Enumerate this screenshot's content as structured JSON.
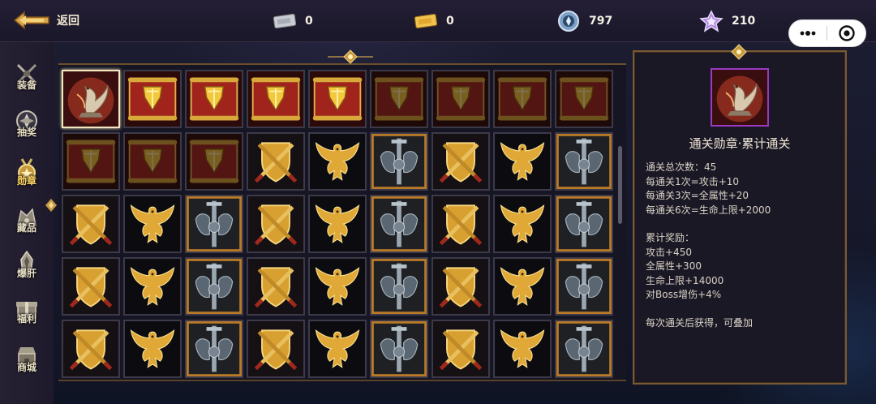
{
  "topbar": {
    "back_label": "返回",
    "currencies": [
      {
        "icon": "silver-ticket-icon",
        "value": "0"
      },
      {
        "icon": "gold-ticket-icon",
        "value": "0"
      },
      {
        "icon": "crystal-coin-icon",
        "value": "797"
      },
      {
        "icon": "purple-star-gem-icon",
        "value": "210"
      }
    ]
  },
  "sidenav": {
    "items": [
      {
        "label": "装备",
        "icon": "crossed-swords-icon"
      },
      {
        "label": "抽奖",
        "icon": "lottery-emblem-icon"
      },
      {
        "label": "勋章",
        "icon": "medal-icon",
        "active": true
      },
      {
        "label": "藏品",
        "icon": "collection-icon"
      },
      {
        "label": "爆肝",
        "icon": "grind-icon"
      },
      {
        "label": "福利",
        "icon": "welfare-icon"
      },
      {
        "label": "商城",
        "icon": "shop-icon"
      }
    ]
  },
  "grid": {
    "rows": [
      [
        "phoenix",
        "scroll",
        "scroll",
        "scroll",
        "scroll",
        "scroll-dim",
        "scroll-dim",
        "scroll-dim",
        "scroll-dim"
      ],
      [
        "scroll-dim",
        "scroll-dim",
        "scroll-dim",
        "shield",
        "eagle",
        "armor",
        "shield",
        "eagle",
        "armor"
      ],
      [
        "shield",
        "eagle",
        "armor",
        "shield",
        "eagle",
        "armor",
        "shield",
        "eagle",
        "armor"
      ],
      [
        "shield",
        "eagle",
        "armor",
        "shield",
        "eagle",
        "armor",
        "shield",
        "eagle",
        "armor"
      ],
      [
        "shield",
        "eagle",
        "armor",
        "shield",
        "eagle",
        "armor",
        "shield",
        "eagle",
        "armor"
      ]
    ],
    "selected": [
      0,
      0
    ]
  },
  "detail": {
    "icon": "phoenix-medal-icon",
    "title": "通关勋章·累计通关",
    "lines": [
      "通关总次数：45",
      "每通关1次=攻击+10",
      "每通关3次=全属性+20",
      "每通关6次=生命上限+2000",
      "",
      "累计奖励：",
      "攻击+450",
      "全属性+300",
      "生命上限+14000",
      "对Boss增伤+4%",
      "",
      "每次通关后获得，可叠加"
    ]
  },
  "colors": {
    "accent_gold": "#ffd76a",
    "panel_border": "#7a5a33",
    "selected_border": "#9a3ac4"
  }
}
